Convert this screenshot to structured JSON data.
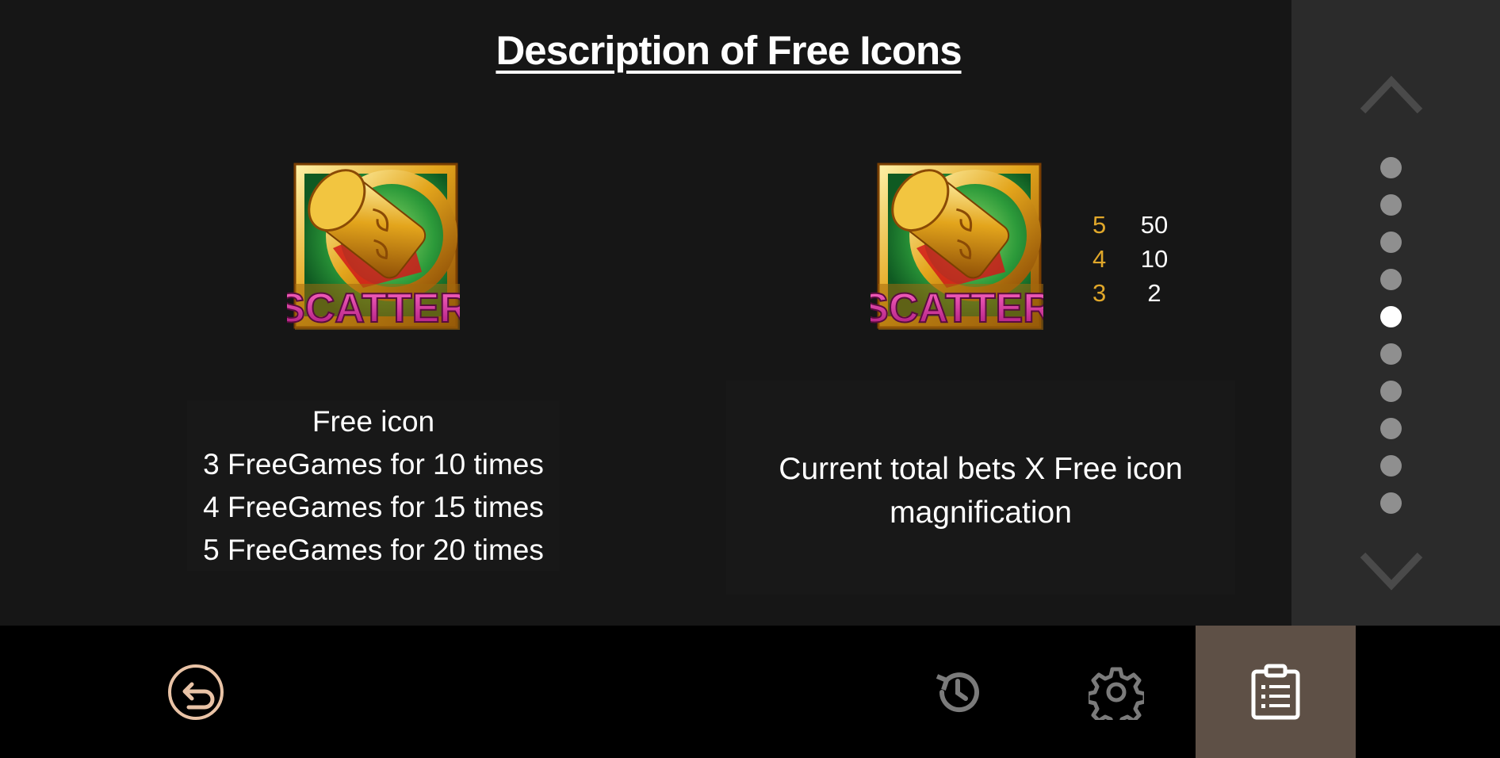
{
  "title": "Description of Free Icons",
  "scatter_label": "SCATTER",
  "left_panel": {
    "lines": [
      "Free icon",
      "3 FreeGames for 10 times",
      "4 FreeGames for 15 times",
      "5 FreeGames for 20 times"
    ]
  },
  "right_panel": {
    "paytable": [
      {
        "count": "5",
        "value": "50"
      },
      {
        "count": "4",
        "value": "10"
      },
      {
        "count": "3",
        "value": "2"
      }
    ],
    "description_line1": "Current total bets X Free icon",
    "description_line2": "magnification"
  },
  "scroller": {
    "page_count": 10,
    "active_page": 5,
    "up_icon": "chevron-up-icon",
    "down_icon": "chevron-down-icon"
  },
  "bottom_bar": {
    "back_icon": "back-arrow-icon",
    "history_icon": "history-icon",
    "settings_icon": "gear-icon",
    "rules_icon": "clipboard-icon"
  },
  "colors": {
    "background": "#161616",
    "scroller_bg": "#2b2b2b",
    "bottom_bar_bg": "#000000",
    "active_tab_bg": "#5e5046",
    "pay_count": "#e0a72a",
    "back_button": "#e9c3a6",
    "dot_inactive": "#8f8f8f",
    "dot_active": "#ffffff"
  }
}
